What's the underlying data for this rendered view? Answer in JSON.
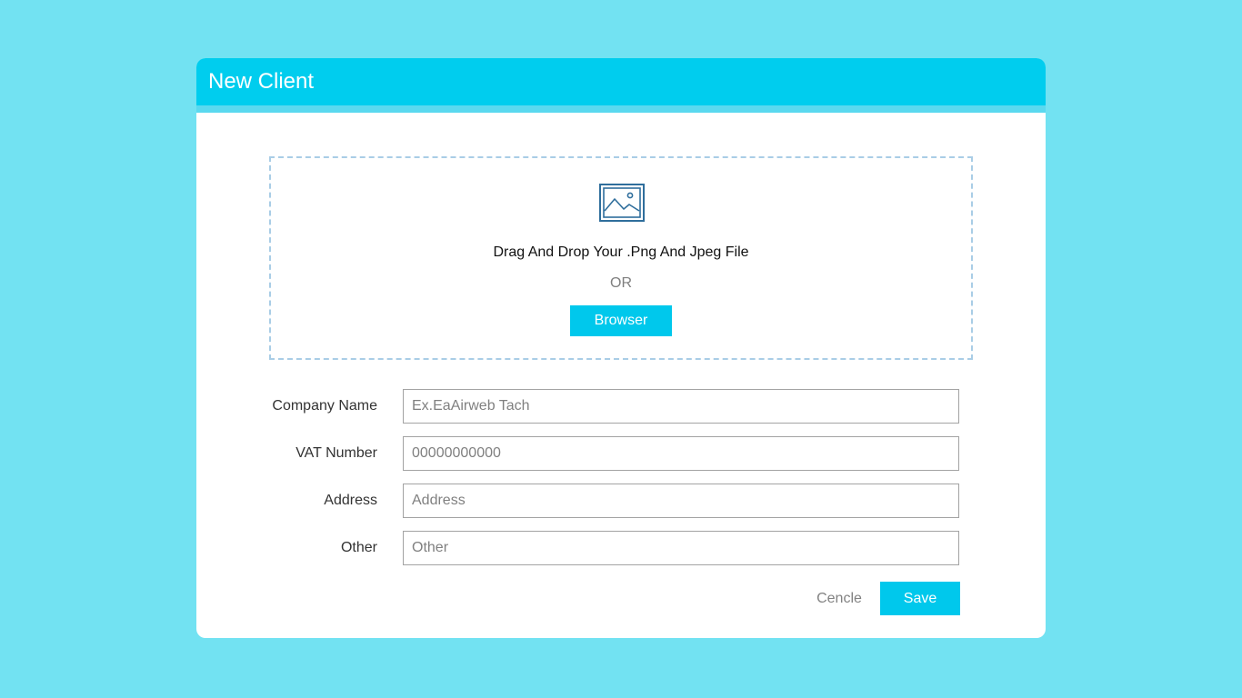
{
  "dialog": {
    "title": "New Client"
  },
  "upload": {
    "icon": "image-icon",
    "drop_text": "Drag And Drop Your .Png And Jpeg File",
    "or_text": "OR",
    "browse_label": "Browser"
  },
  "form": {
    "fields": [
      {
        "label": "Company Name",
        "placeholder": "Ex.EaAirweb Tach",
        "value": ""
      },
      {
        "label": "VAT Number",
        "placeholder": "00000000000",
        "value": ""
      },
      {
        "label": "Address",
        "placeholder": "Address",
        "value": ""
      },
      {
        "label": "Other",
        "placeholder": "Other",
        "value": ""
      }
    ]
  },
  "actions": {
    "cancel_label": "Cencle",
    "save_label": "Save"
  },
  "colors": {
    "page_background": "#72e2f2",
    "accent": "#00c8ec",
    "header": "#00cdee",
    "dropzone_border": "#a9cde6",
    "icon_stroke": "#2f6e9c"
  }
}
